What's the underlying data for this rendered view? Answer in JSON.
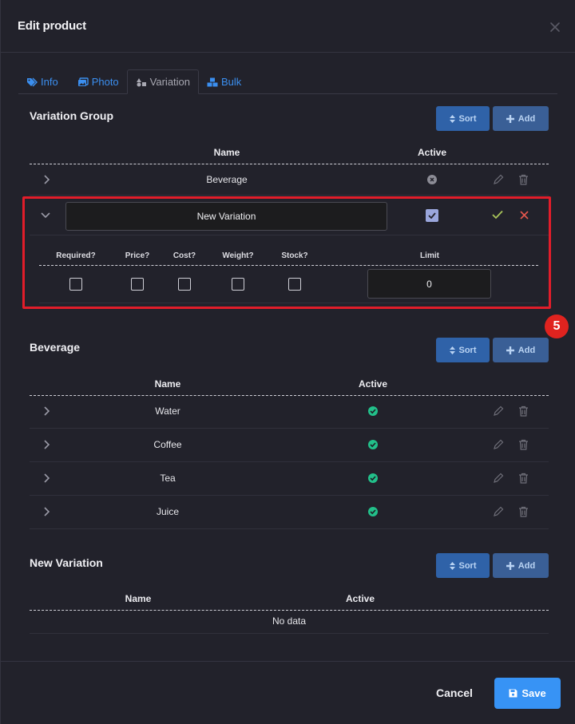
{
  "modal": {
    "title": "Edit product"
  },
  "tabs": [
    {
      "label": "Info",
      "icon": "tags-icon",
      "active": false
    },
    {
      "label": "Photo",
      "icon": "images-icon",
      "active": false
    },
    {
      "label": "Variation",
      "icon": "shapes-icon",
      "active": true
    },
    {
      "label": "Bulk",
      "icon": "boxes-icon",
      "active": false
    }
  ],
  "buttons": {
    "sort": "Sort",
    "add": "Add"
  },
  "variation_group": {
    "title": "Variation Group",
    "columns": {
      "name": "Name",
      "active": "Active"
    },
    "rows": [
      {
        "name": "Beverage",
        "active": false
      }
    ],
    "editing": {
      "name_value": "New Variation",
      "active": true,
      "options": [
        "Required?",
        "Price?",
        "Cost?",
        "Weight?",
        "Stock?"
      ],
      "limit_label": "Limit",
      "limit_value": "0"
    }
  },
  "badge": "5",
  "beverage": {
    "title": "Beverage",
    "columns": {
      "name": "Name",
      "active": "Active"
    },
    "rows": [
      {
        "name": "Water",
        "active": true
      },
      {
        "name": "Coffee",
        "active": true
      },
      {
        "name": "Tea",
        "active": true
      },
      {
        "name": "Juice",
        "active": true
      }
    ]
  },
  "new_variation": {
    "title": "New Variation",
    "columns": {
      "name": "Name",
      "active": "Active"
    },
    "empty_text": "No data"
  },
  "footer": {
    "cancel": "Cancel",
    "save": "Save"
  },
  "colors": {
    "primary": "#3793f5",
    "highlight": "#e11d2a",
    "active_green": "#22c08a"
  }
}
